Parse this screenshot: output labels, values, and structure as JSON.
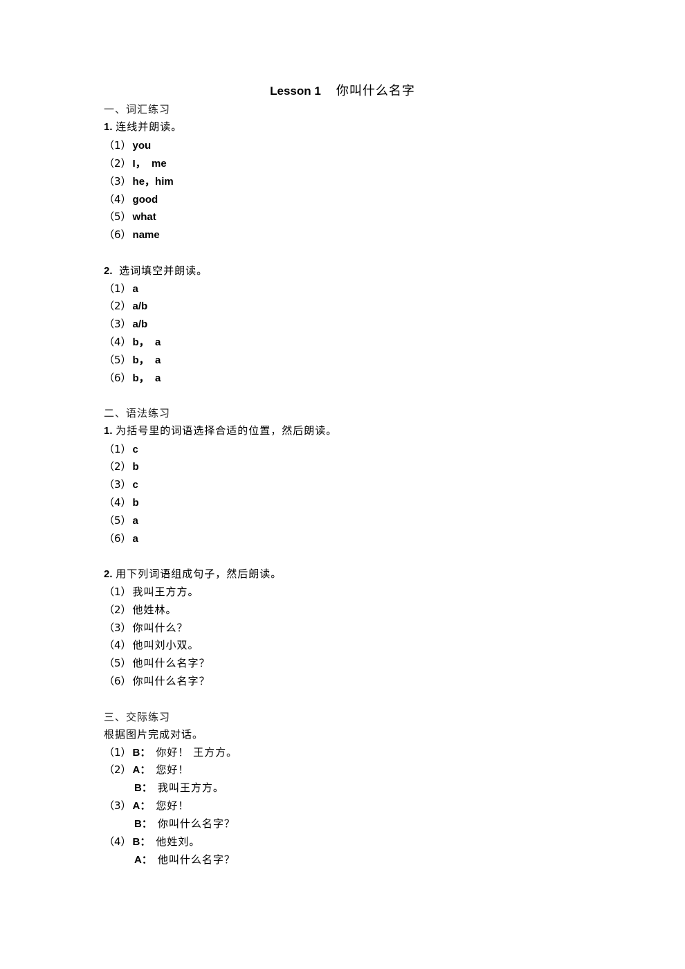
{
  "title": {
    "lesson": "Lesson 1",
    "name": "你叫什么名字"
  },
  "sections": {
    "vocab": {
      "heading": "一、词汇练习",
      "ex1": {
        "number": "1.",
        "instruction": "连线并朗读。",
        "items": [
          {
            "label": "（1）",
            "answer": "you"
          },
          {
            "label": "（2）",
            "answer": "I，  me"
          },
          {
            "label": "（3）",
            "answer": "he，him"
          },
          {
            "label": "（4）",
            "answer": "good"
          },
          {
            "label": "（5）",
            "answer": "what"
          },
          {
            "label": "（6）",
            "answer": "name"
          }
        ]
      },
      "ex2": {
        "number": "2.",
        "instruction": "选词填空并朗读。",
        "items": [
          {
            "label": "（1）",
            "answer": "a"
          },
          {
            "label": "（2）",
            "answer": "a/b"
          },
          {
            "label": "（3）",
            "answer": "a/b"
          },
          {
            "label": "（4）",
            "answer": "b，  a"
          },
          {
            "label": "（5）",
            "answer": "b，  a"
          },
          {
            "label": "（6）",
            "answer": "b，  a"
          }
        ]
      }
    },
    "grammar": {
      "heading": "二、语法练习",
      "ex1": {
        "number": "1.",
        "instruction": "为括号里的词语选择合适的位置，然后朗读。",
        "items": [
          {
            "label": "（1）",
            "answer": "c"
          },
          {
            "label": "（2）",
            "answer": "b"
          },
          {
            "label": "（3）",
            "answer": "c"
          },
          {
            "label": "（4）",
            "answer": "b"
          },
          {
            "label": "（5）",
            "answer": "a"
          },
          {
            "label": "（6）",
            "answer": "a"
          }
        ]
      },
      "ex2": {
        "number": "2.",
        "instruction": "用下列词语组成句子，然后朗读。",
        "items": [
          {
            "label": "（1）",
            "answer": "我叫王方方。"
          },
          {
            "label": "（2）",
            "answer": "他姓林。"
          },
          {
            "label": "（3）",
            "answer": "你叫什么？"
          },
          {
            "label": "（4）",
            "answer": "他叫刘小双。"
          },
          {
            "label": "（5）",
            "answer": "他叫什么名字？"
          },
          {
            "label": "（6）",
            "answer": "你叫什么名字？"
          }
        ]
      }
    },
    "communication": {
      "heading": "三、交际练习",
      "instruction": "根据图片完成对话。",
      "dialogues": [
        {
          "label": "（1）",
          "lines": [
            {
              "speaker": "B：",
              "text": "你好！ 王方方。"
            }
          ]
        },
        {
          "label": "（2）",
          "lines": [
            {
              "speaker": "A：",
              "text": "您好！"
            },
            {
              "speaker": "B：",
              "text": "我叫王方方。"
            }
          ]
        },
        {
          "label": "（3）",
          "lines": [
            {
              "speaker": "A：",
              "text": "您好！"
            },
            {
              "speaker": "B：",
              "text": "你叫什么名字？"
            }
          ]
        },
        {
          "label": "（4）",
          "lines": [
            {
              "speaker": "B：",
              "text": "他姓刘。"
            },
            {
              "speaker": "A：",
              "text": "他叫什么名字？"
            }
          ]
        }
      ]
    }
  }
}
